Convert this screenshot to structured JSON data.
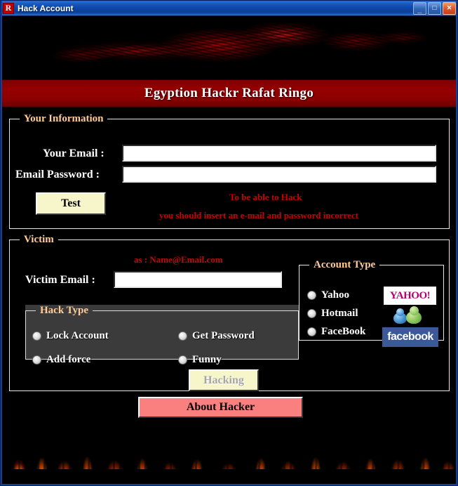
{
  "window": {
    "title": "Hack Account",
    "icon": "app-r-icon",
    "controls": {
      "minimize": "minimize-icon",
      "maximize": "maximize-icon",
      "close": "close-icon"
    }
  },
  "banner": {
    "headline": "Egyption Hackr Rafat Ringo",
    "band_color": "#960000"
  },
  "your_information": {
    "legend": "Your Information",
    "email_label": "Your Email :",
    "email_value": "",
    "email_placeholder": "",
    "password_label": "Email Password :",
    "password_value": "",
    "password_placeholder": "",
    "test_button": "Test",
    "warning_line1": "To be able to Hack",
    "warning_line2": "you should insert an e-mail and password incorrect",
    "warning_color": "#cc0000"
  },
  "victim": {
    "legend": "Victim",
    "hint": "as : Name@Email.com",
    "email_label": "Victim Email :",
    "email_value": "",
    "email_placeholder": "",
    "hacking_button": "Hacking"
  },
  "hack_type": {
    "legend": "Hack Type",
    "options": [
      {
        "label": "Lock Account",
        "selected": false
      },
      {
        "label": "Get Password",
        "selected": false
      },
      {
        "label": "Add force",
        "selected": false
      },
      {
        "label": "Funny",
        "selected": false
      }
    ]
  },
  "account_type": {
    "legend": "Account Type",
    "options": [
      {
        "label": "Yahoo",
        "selected": false,
        "logo": "yahoo-logo",
        "logo_text": "YAHOO!"
      },
      {
        "label": "Hotmail",
        "selected": false,
        "logo": "msn-messenger-logo",
        "logo_text": ""
      },
      {
        "label": "FaceBook",
        "selected": false,
        "logo": "facebook-logo",
        "logo_text": "facebook"
      }
    ]
  },
  "footer": {
    "about_button": "About Hacker"
  },
  "colors": {
    "legend": "#ffcc99",
    "label": "#ffffff",
    "accent_red": "#960000",
    "button_cream": "#f7f6cb",
    "button_salmon": "#fa8080",
    "facebook_blue": "#3b5998"
  }
}
